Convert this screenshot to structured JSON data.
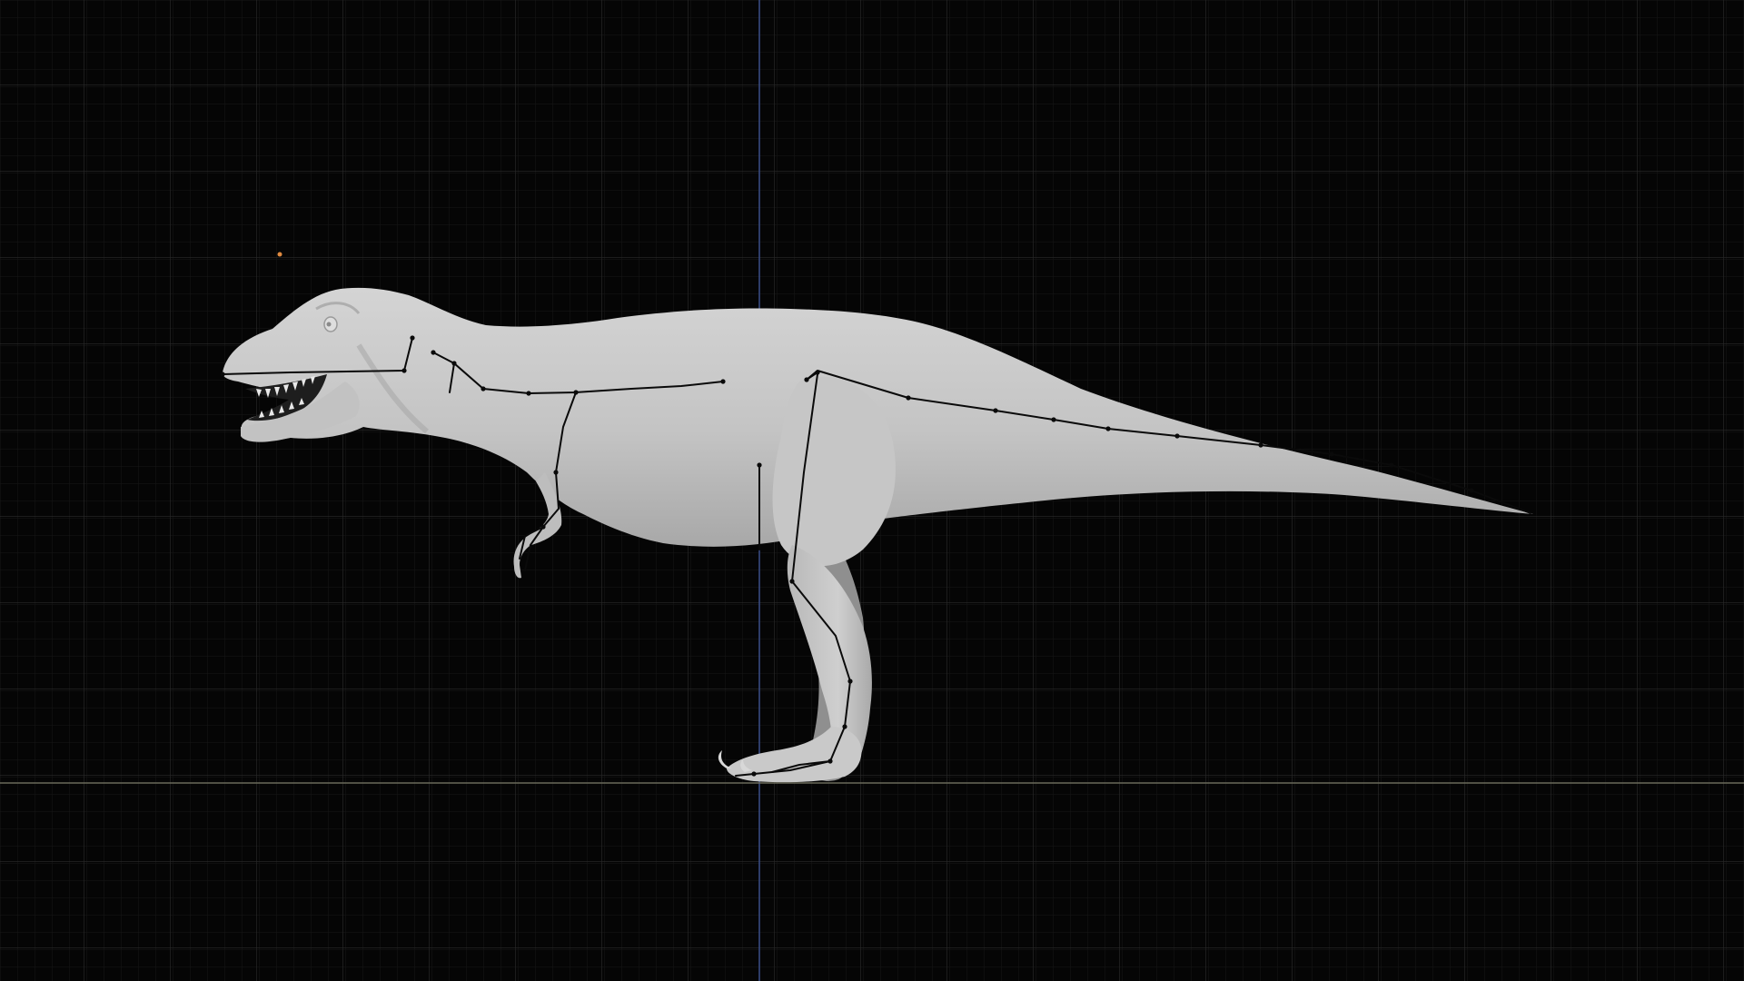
{
  "viewport": {
    "view": "orthographic-side",
    "grid": true,
    "background_color": "#050505",
    "grid_minor_color": "#1a1a1a",
    "grid_major_color": "#2c2c2c",
    "axis_vertical_color": "#3b4f8a",
    "axis_horizontal_color": "#6a6a5a",
    "mesh_color": "#c8c8c8",
    "armature_color": "#0a0a0a",
    "light_marker_color": "#e08a40"
  },
  "scene": {
    "object": "tyrannosaurus-model",
    "armature": "skeleton-rig",
    "light": "point-light"
  }
}
